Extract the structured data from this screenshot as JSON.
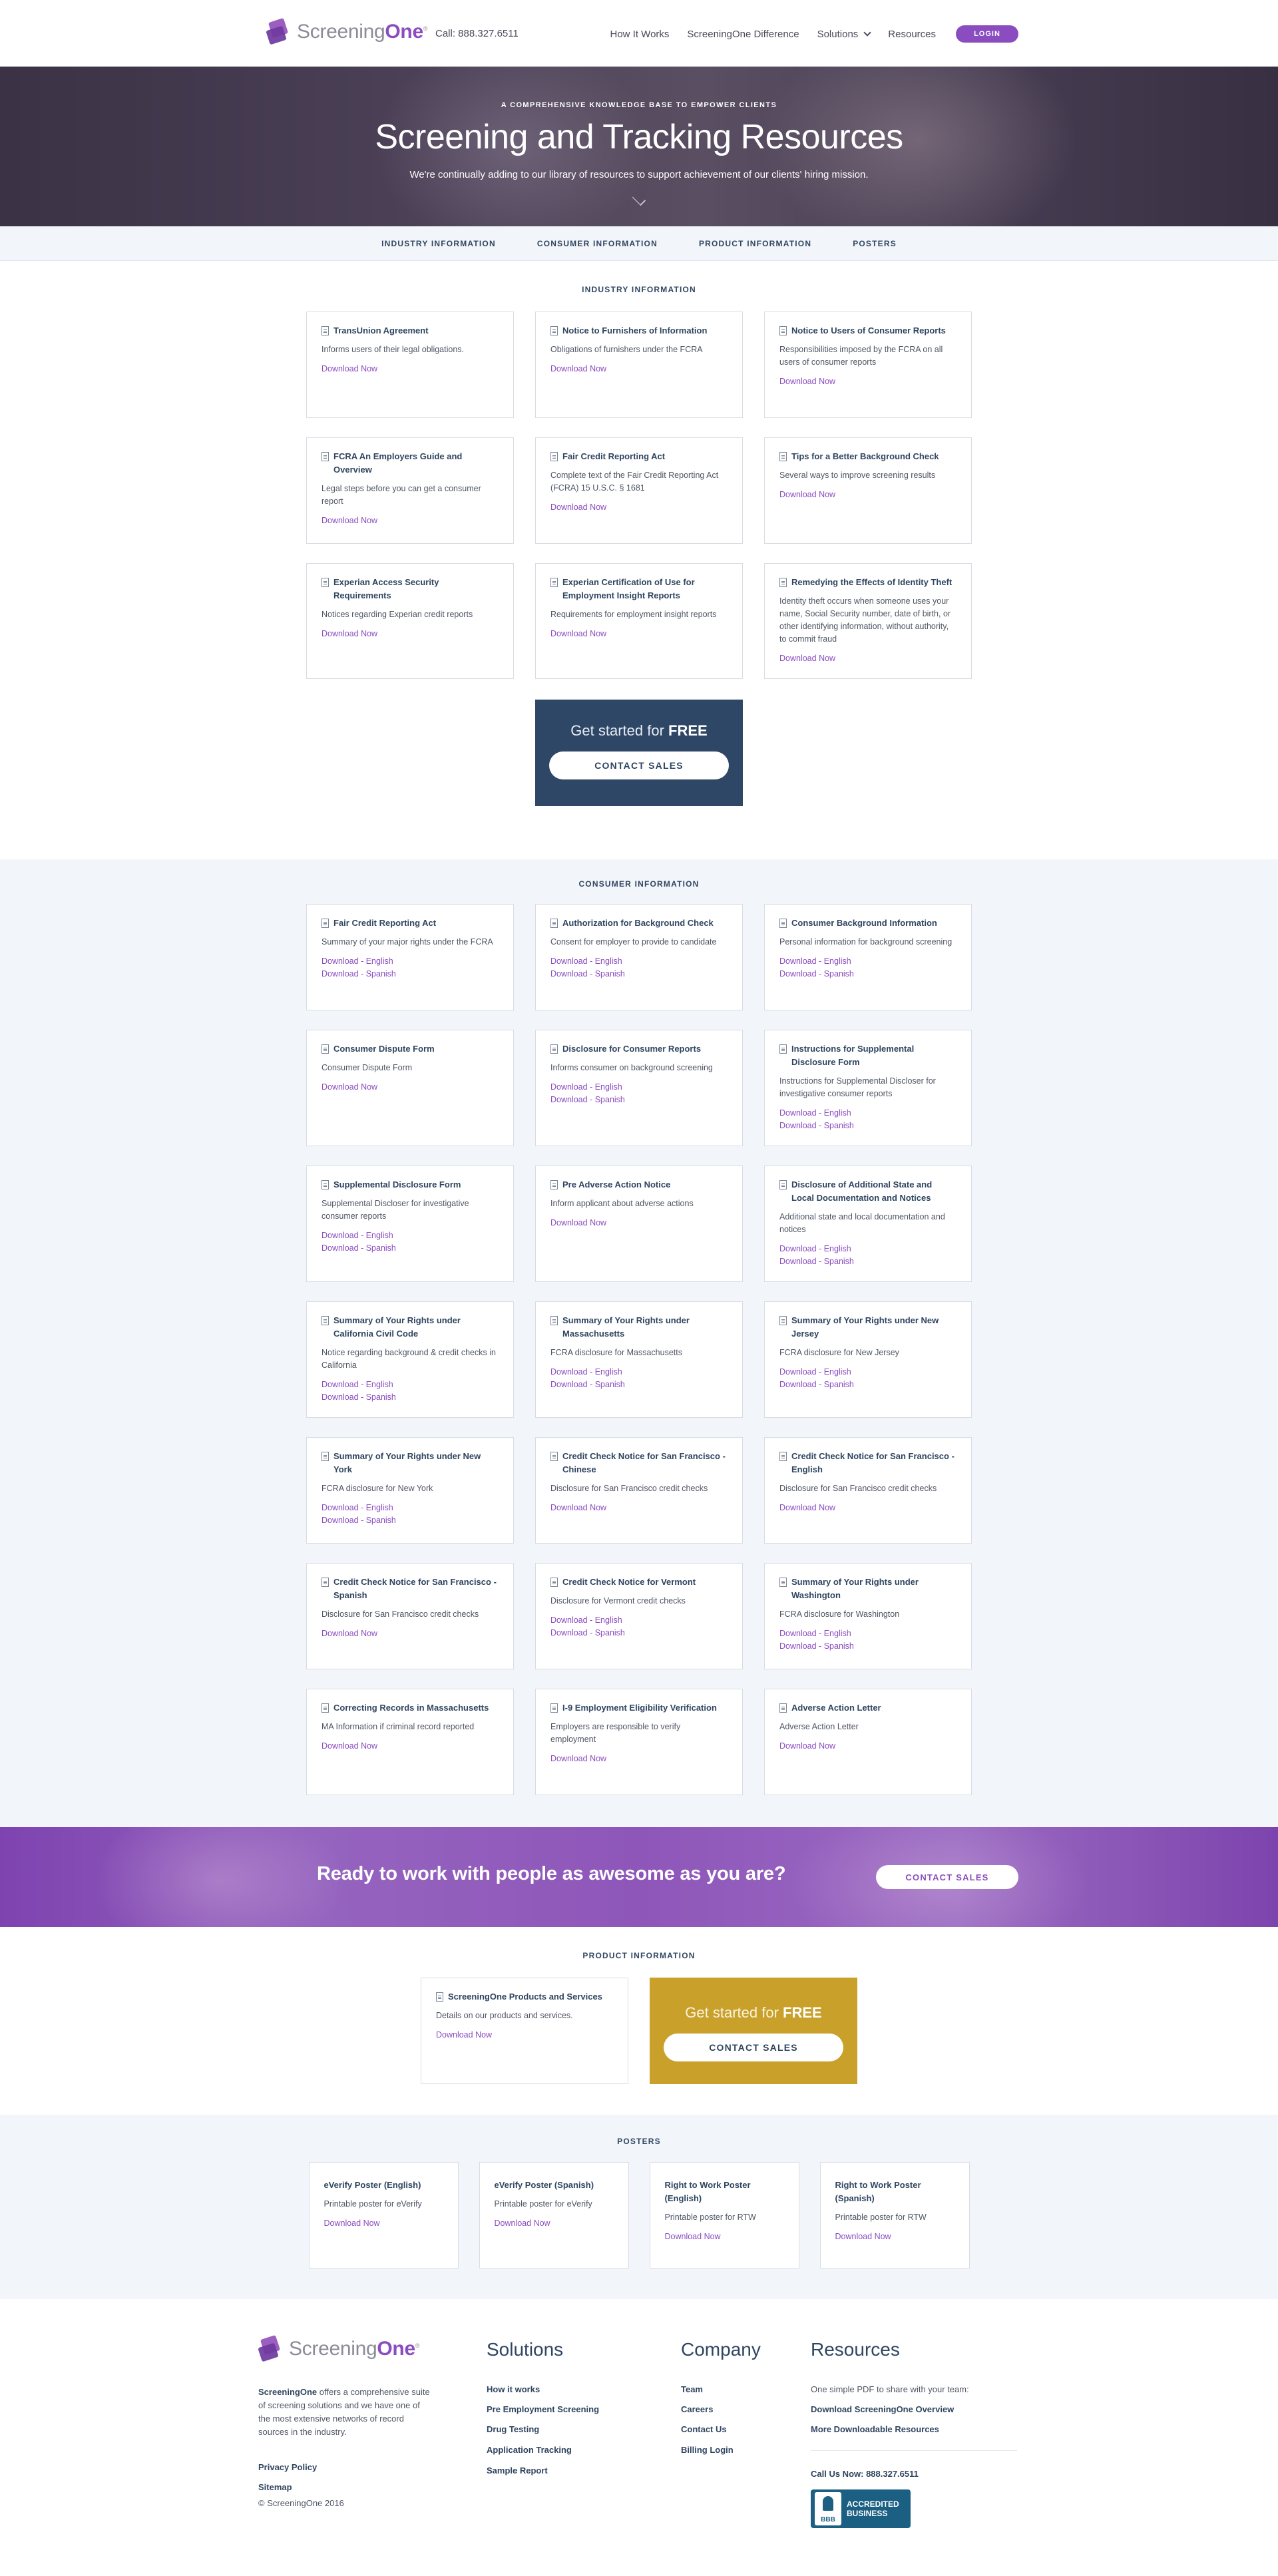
{
  "header": {
    "logo_prefix": "Screening",
    "logo_suffix": "One",
    "logo_mark": "®",
    "phone": "Call: 888.327.6511",
    "nav": [
      "How It Works",
      "ScreeningOne Difference",
      "Solutions",
      "Resources"
    ],
    "login": "LOGIN"
  },
  "hero": {
    "kicker": "A COMPREHENSIVE KNOWLEDGE BASE TO EMPOWER CLIENTS",
    "title": "Screening and Tracking Resources",
    "subtitle": "We're continually adding to our library of resources to support achievement of our clients' hiring mission."
  },
  "tabs": [
    "INDUSTRY INFORMATION",
    "CONSUMER INFORMATION",
    "PRODUCT INFORMATION",
    "POSTERS"
  ],
  "industry": {
    "title": "INDUSTRY INFORMATION",
    "cards": [
      {
        "title": "TransUnion Agreement",
        "desc": "Informs users of their legal obligations.",
        "links": [
          "Download Now"
        ]
      },
      {
        "title": "Notice to Furnishers of Information",
        "desc": "Obligations of furnishers under the FCRA",
        "links": [
          "Download Now"
        ]
      },
      {
        "title": "Notice to Users of Consumer Reports",
        "desc": "Responsibilities imposed by the FCRA on all users of consumer reports",
        "links": [
          "Download Now"
        ]
      },
      {
        "title": "FCRA An Employers Guide and Overview",
        "desc": "Legal steps before you can get a consumer report",
        "links": [
          "Download Now"
        ]
      },
      {
        "title": "Fair Credit Reporting Act",
        "desc": "Complete text of the Fair Credit Reporting Act (FCRA) 15 U.S.C. § 1681",
        "links": [
          "Download Now"
        ]
      },
      {
        "title": "Tips for a Better Background Check",
        "desc": "Several ways to improve screening results",
        "links": [
          "Download Now"
        ]
      },
      {
        "title": "Experian Access Security Requirements",
        "desc": "Notices regarding Experian credit reports",
        "links": [
          "Download Now"
        ]
      },
      {
        "title": "Experian Certification of Use for Employment Insight Reports",
        "desc": "Requirements for employment insight reports",
        "links": [
          "Download Now"
        ]
      },
      {
        "title": "Remedying the Effects of Identity Theft",
        "desc": "Identity theft occurs when someone uses your name, Social Security number, date of birth, or other identifying information, without authority, to commit fraud",
        "links": [
          "Download Now"
        ]
      }
    ],
    "cta_text": "Get started for",
    "cta_strong": "FREE",
    "cta_button": "CONTACT SALES"
  },
  "consumer": {
    "title": "CONSUMER INFORMATION",
    "cards": [
      {
        "title": "Fair Credit Reporting Act",
        "desc": "Summary of your major rights under the FCRA",
        "links": [
          "Download - English",
          "Download - Spanish"
        ]
      },
      {
        "title": "Authorization for Background Check",
        "desc": "Consent for employer to provide to candidate",
        "links": [
          "Download - English",
          "Download - Spanish"
        ]
      },
      {
        "title": "Consumer Background Information",
        "desc": "Personal information for background screening",
        "links": [
          "Download - English",
          "Download - Spanish"
        ]
      },
      {
        "title": "Consumer Dispute Form",
        "desc": "Consumer Dispute Form",
        "links": [
          "Download Now"
        ]
      },
      {
        "title": "Disclosure for Consumer Reports",
        "desc": "Informs consumer on background screening",
        "links": [
          "Download - English",
          "Download - Spanish"
        ]
      },
      {
        "title": "Instructions for Supplemental Disclosure Form",
        "desc": "Instructions for Supplemental Discloser for investigative consumer reports",
        "links": [
          "Download - English",
          "Download - Spanish"
        ]
      },
      {
        "title": "Supplemental Disclosure Form",
        "desc": "Supplemental Discloser for investigative consumer reports",
        "links": [
          "Download - English",
          "Download - Spanish"
        ]
      },
      {
        "title": "Pre Adverse Action Notice",
        "desc": "Inform applicant about adverse actions",
        "links": [
          "Download Now"
        ]
      },
      {
        "title": "Disclosure of Additional State and Local Documentation and Notices",
        "desc": "Additional state and local documentation and notices",
        "links": [
          "Download - English",
          "Download - Spanish"
        ]
      },
      {
        "title": "Summary of Your Rights under California Civil Code",
        "desc": "Notice regarding background & credit checks in California",
        "links": [
          "Download - English",
          "Download - Spanish"
        ]
      },
      {
        "title": "Summary of Your Rights under Massachusetts",
        "desc": "FCRA disclosure for Massachusetts",
        "links": [
          "Download - English",
          "Download - Spanish"
        ]
      },
      {
        "title": "Summary of Your Rights under New Jersey",
        "desc": "FCRA disclosure for New Jersey",
        "links": [
          "Download - English",
          "Download - Spanish"
        ]
      },
      {
        "title": "Summary of Your Rights under New York",
        "desc": "FCRA disclosure for New York",
        "links": [
          "Download - English",
          "Download - Spanish"
        ]
      },
      {
        "title": "Credit Check Notice for San Francisco - Chinese",
        "desc": "Disclosure for San Francisco credit checks",
        "links": [
          "Download Now"
        ]
      },
      {
        "title": "Credit Check Notice for San Francisco - English",
        "desc": "Disclosure for San Francisco credit checks",
        "links": [
          "Download Now"
        ]
      },
      {
        "title": "Credit Check Notice for San Francisco - Spanish",
        "desc": "Disclosure for San Francisco credit checks",
        "links": [
          "Download Now"
        ]
      },
      {
        "title": "Credit Check Notice for Vermont",
        "desc": "Disclosure for Vermont credit checks",
        "links": [
          "Download - English",
          "Download - Spanish"
        ]
      },
      {
        "title": "Summary of Your Rights under Washington",
        "desc": "FCRA disclosure for Washington",
        "links": [
          "Download - English",
          "Download - Spanish"
        ]
      },
      {
        "title": "Correcting Records in Massachusetts",
        "desc": "MA Information if criminal record reported",
        "links": [
          "Download Now"
        ]
      },
      {
        "title": "I-9 Employment Eligibility Verification",
        "desc": "Employers are responsible to verify employment",
        "links": [
          "Download Now"
        ]
      },
      {
        "title": "Adverse Action Letter",
        "desc": "Adverse Action Letter",
        "links": [
          "Download Now"
        ]
      }
    ]
  },
  "banner": {
    "text": "Ready to work with people as awesome as you are?",
    "button": "CONTACT SALES"
  },
  "product": {
    "title": "PRODUCT INFORMATION",
    "card": {
      "title": "ScreeningOne Products and Services",
      "desc": "Details on our products and services.",
      "link": "Download Now"
    },
    "cta_text": "Get started for",
    "cta_strong": "FREE",
    "cta_button": "CONTACT SALES"
  },
  "posters": {
    "title": "POSTERS",
    "cards": [
      {
        "title": "eVerify Poster (English)",
        "desc": "Printable poster for eVerify",
        "link": "Download Now"
      },
      {
        "title": "eVerify Poster (Spanish)",
        "desc": "Printable poster for eVerify",
        "link": "Download Now"
      },
      {
        "title": "Right to Work Poster (English)",
        "desc": "Printable poster for RTW",
        "link": "Download Now"
      },
      {
        "title": "Right to Work Poster (Spanish)",
        "desc": "Printable poster for RTW",
        "link": "Download Now"
      }
    ]
  },
  "footer": {
    "about_brand": "ScreeningOne",
    "about_text": " offers a comprehensive suite of screening solutions and we have one of the most extensive networks of record sources in the industry.",
    "privacy": "Privacy Policy",
    "sitemap": "Sitemap",
    "copyright": "© ScreeningOne 2016",
    "solutions": {
      "heading": "Solutions",
      "links": [
        "How it works",
        "Pre Employment Screening",
        "Drug Testing",
        "Application Tracking",
        "Sample Report"
      ]
    },
    "company": {
      "heading": "Company",
      "links": [
        "Team",
        "Careers",
        "Contact Us",
        "Billing Login"
      ]
    },
    "resources": {
      "heading": "Resources",
      "intro": "One simple PDF to share with your team:",
      "links": [
        "Download ScreeningOne Overview",
        "More Downloadable Resources"
      ],
      "call": "Call Us Now: 888.327.6511"
    },
    "bbb": {
      "seal": "BBB",
      "line1": "ACCREDITED",
      "line2": "BUSINESS"
    }
  },
  "colors": {
    "purple": "#8a4cbf",
    "navy": "#2f4766",
    "gold": "#c9a02a",
    "light_bg": "#f2f5f9"
  },
  "icons": [
    "document-icon",
    "chevron-down-icon",
    "logo-mark-icon",
    "bbb-seal-icon"
  ]
}
